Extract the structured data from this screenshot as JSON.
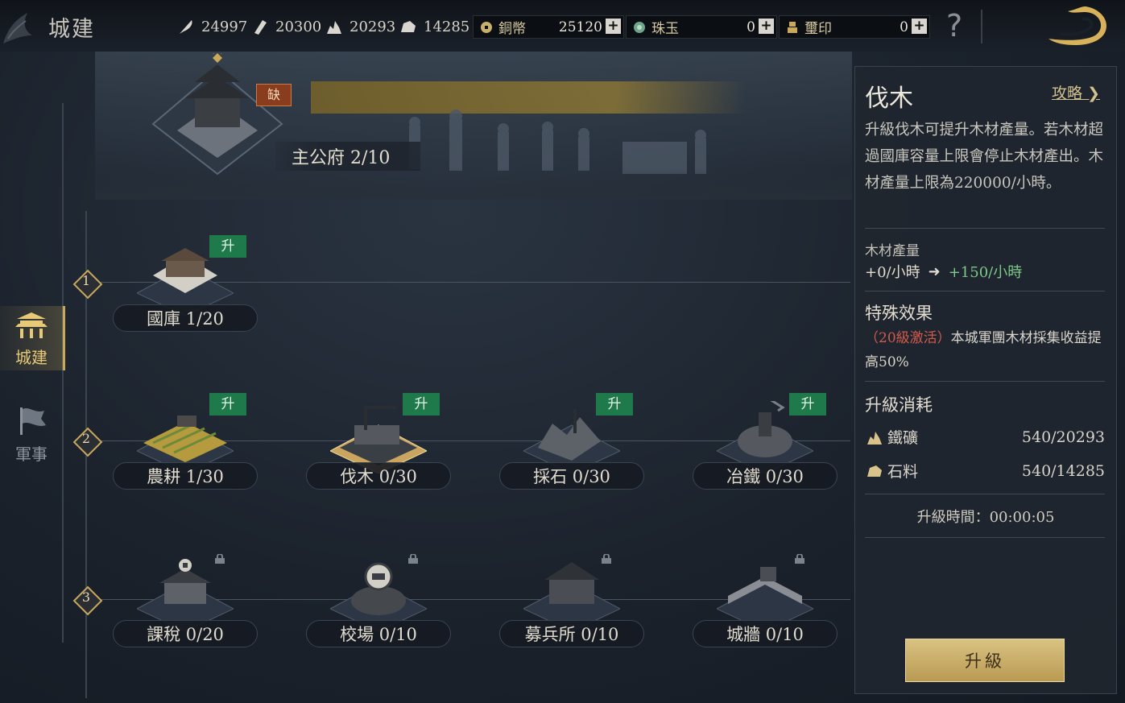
{
  "header": {
    "title": "城建",
    "resources": [
      {
        "icon": "feather-icon",
        "value": "24997"
      },
      {
        "icon": "wood-icon",
        "value": "20300"
      },
      {
        "icon": "iron-ore-icon",
        "value": "20293"
      },
      {
        "icon": "stone-icon",
        "value": "14285"
      }
    ],
    "currencies": [
      {
        "icon": "copper-coin-icon",
        "name": "銅幣",
        "value": "25120"
      },
      {
        "icon": "jade-icon",
        "name": "珠玉",
        "value": "0"
      },
      {
        "icon": "seal-icon",
        "name": "璽印",
        "value": "0"
      }
    ],
    "plus": "+",
    "help": "?"
  },
  "nav": {
    "items": [
      {
        "label": "城建",
        "icon": "palace-icon",
        "active": true
      },
      {
        "label": "軍事",
        "icon": "flag-icon",
        "active": false
      }
    ]
  },
  "banner": {
    "missing_badge": "缺",
    "hall_label": "主公府 2/10"
  },
  "tiers": [
    "1",
    "2",
    "3"
  ],
  "buildings": {
    "row1": [
      {
        "label": "國庫 1/20",
        "badge": "升"
      }
    ],
    "row2": [
      {
        "label": "農耕 1/30",
        "badge": "升"
      },
      {
        "label": "伐木 0/30",
        "badge": "升"
      },
      {
        "label": "採石 0/30",
        "badge": "升"
      },
      {
        "label": "冶鐵 0/30",
        "badge": "升"
      }
    ],
    "row3": [
      {
        "label": "課稅 0/20"
      },
      {
        "label": "校場 0/10"
      },
      {
        "label": "募兵所 0/10"
      },
      {
        "label": "城牆 0/10"
      }
    ]
  },
  "panel": {
    "title": "伐木",
    "guide": "攻略",
    "description": "升級伐木可提升木材產量。若木材超過國庫容量上限會停止木材產出。木材產量上限為220000/小時。",
    "production_label": "木材產量",
    "production_current": "+0/小時",
    "production_next": "+150/小時",
    "special_title": "特殊效果",
    "special_activation": "（20級激活）",
    "special_text": "本城軍團木材採集收益提高50%",
    "cost_title": "升級消耗",
    "costs": [
      {
        "icon": "iron-ore-icon",
        "name": "鐵礦",
        "amount": "540/20293"
      },
      {
        "icon": "stone-icon",
        "name": "石料",
        "amount": "540/14285"
      }
    ],
    "time": "升級時間：00:00:05",
    "upgrade_button": "升級"
  },
  "colors": {
    "accent_gold": "#c9a85a",
    "upgrade_green": "#1e7a4a",
    "positive_green": "#7cc98a",
    "activation_red": "#d25a4d"
  }
}
